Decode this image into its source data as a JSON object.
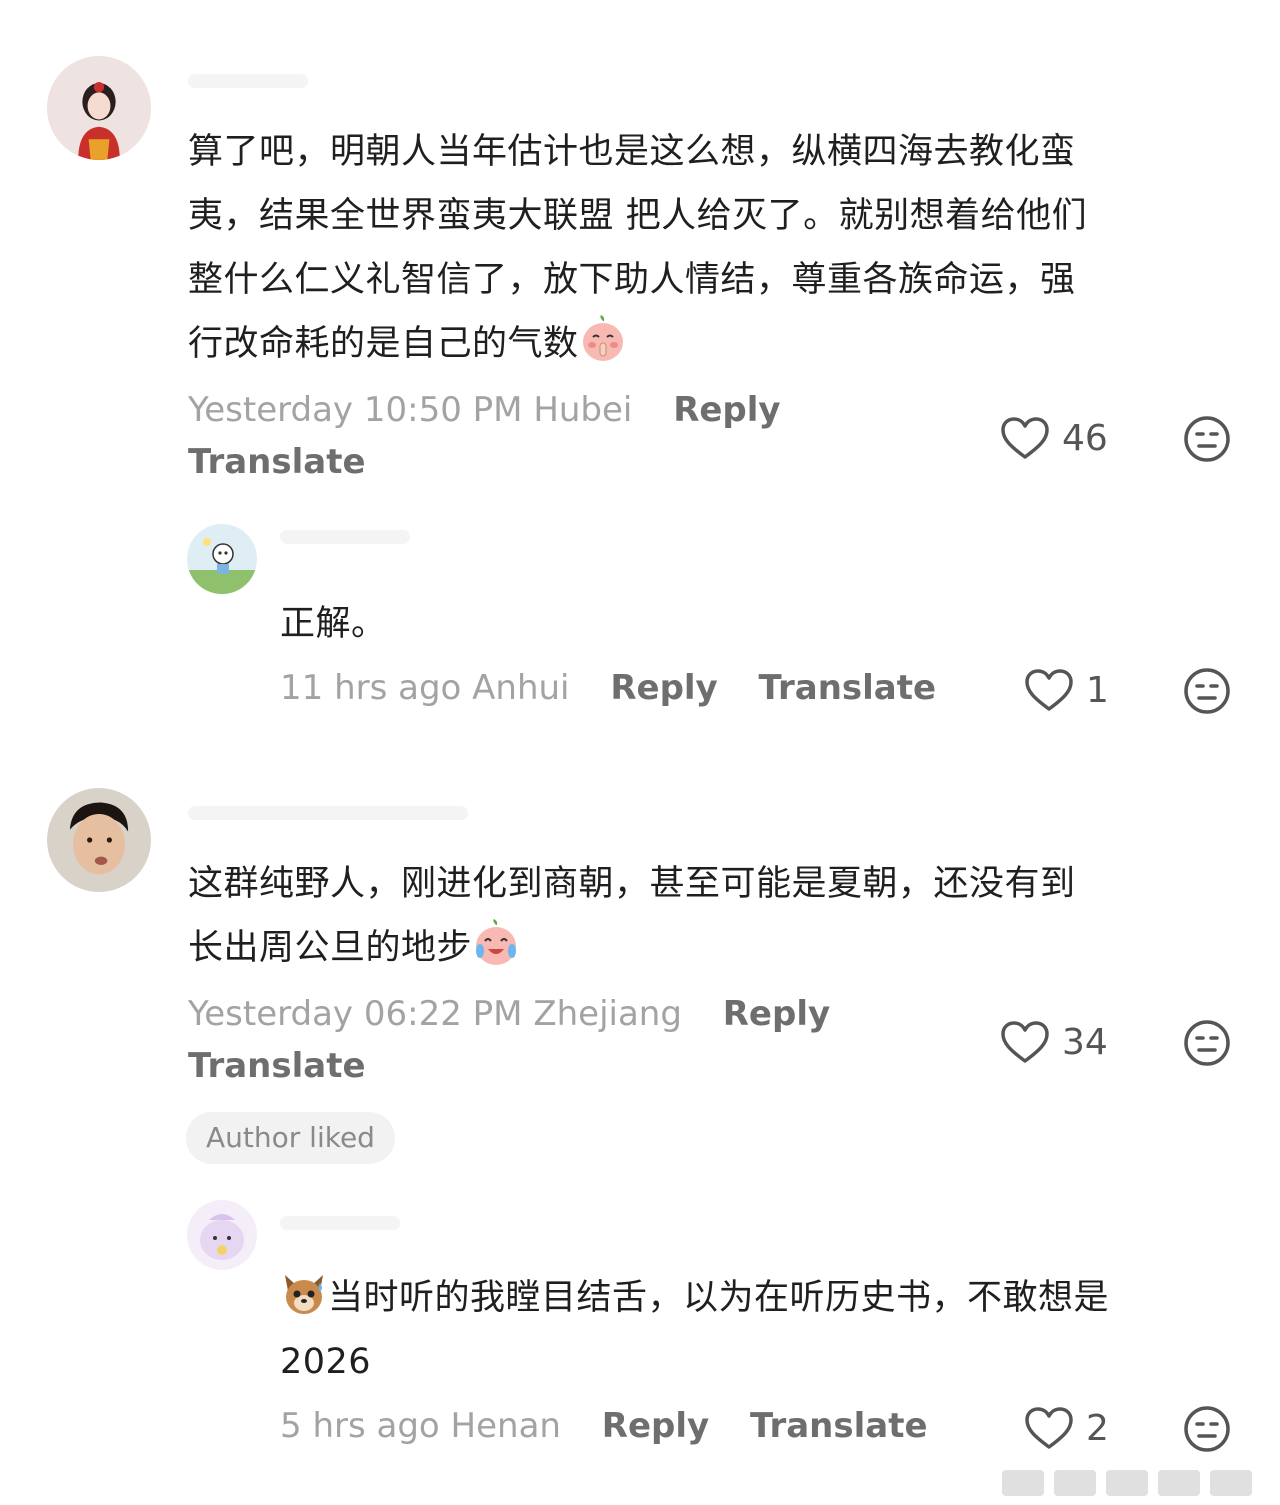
{
  "comments": [
    {
      "text": "算了吧，明朝人当年估计也是这么想，纵横四海去教化蛮夷，结果全世界蛮夷大联盟 把人给灭了。就别想着给他们整什么仁义礼智信了，放下助人情结，尊重各族命运，强行改命耗的是自己的气数",
      "line1": "算了吧，明朝人当年估计也是这么想，纵横四海去教化蛮",
      "line2": "夷，结果全世界蛮夷大联盟 把人给灭了。就别想着给他们",
      "line3": "整什么仁义礼智信了，放下助人情结，尊重各族命运，强",
      "line4": "行改命耗的是自己的气数",
      "emoji": "shush-peach-emoji",
      "time": "Yesterday 10:50 PM",
      "region": "Hubei",
      "reply": "Reply",
      "translate": "Translate",
      "likes": "46"
    },
    {
      "text": "正解。",
      "time": "11 hrs ago",
      "region": "Anhui",
      "reply": "Reply",
      "translate": "Translate",
      "likes": "1"
    },
    {
      "line1": "这群纯野人，刚进化到商朝，甚至可能是夏朝，还没有到",
      "line2": "长出周公旦的地步",
      "emoji": "crying-laughing-peach-emoji",
      "time": "Yesterday 06:22 PM",
      "region": "Zhejiang",
      "reply": "Reply",
      "translate": "Translate",
      "likes": "34",
      "badge": "Author liked"
    },
    {
      "line1": "当时听的我瞠目结舌，以为在听历史书，不敢想是",
      "line2": "2026",
      "emoji": "sweating-dog-emoji",
      "time": "5 hrs ago",
      "region": "Henan",
      "reply": "Reply",
      "translate": "Translate",
      "likes": "2"
    }
  ],
  "icons": {
    "like": "heart-outline-icon",
    "dislike": "neutral-face-icon"
  },
  "colors": {
    "meta_gray": "#a3a3a3",
    "action_gray": "#6e6e6e",
    "text": "#1f1f1f"
  }
}
